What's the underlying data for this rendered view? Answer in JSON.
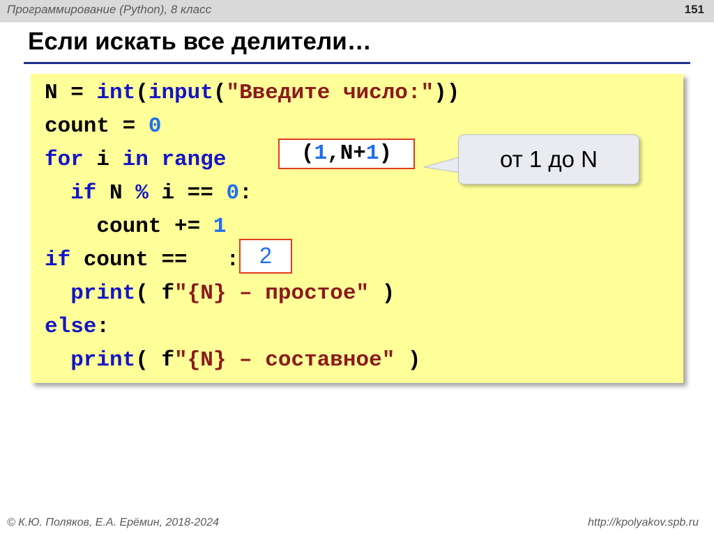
{
  "header": {
    "course": "Программирование (Python), 8 класс",
    "slide_number": "151"
  },
  "title": "Если искать все делители…",
  "code": {
    "line1": {
      "a": "N = ",
      "b": "int",
      "c": "(",
      "d": "input",
      "e": "(",
      "f": "\"Введите число:\"",
      "g": "))"
    },
    "line2": {
      "a": "count = ",
      "b": "0"
    },
    "line3": {
      "a": "for",
      "b": " i ",
      "c": "in",
      "d": " range",
      "e": ":"
    },
    "line4": {
      "a": "  if",
      "b": " N ",
      "c": "%",
      "d": " i == ",
      "e": "0",
      "f": ":"
    },
    "line5": {
      "a": "    count += ",
      "b": "1"
    },
    "line6": {
      "a": "if",
      "b": " count == ",
      "c": "  ",
      "d": ":"
    },
    "line7": {
      "a": "  print",
      "b": "( f",
      "c": "\"{N} – простое\"",
      "d": " )"
    },
    "line8": {
      "a": "else",
      "b": ":"
    },
    "line9": {
      "a": "  print",
      "b": "( f",
      "c": "\"{N} – составное\"",
      "d": " )"
    }
  },
  "highlight_range": {
    "open": "(",
    "one": "1",
    "mid": ",N+",
    "one2": "1",
    "close": ")"
  },
  "highlight_two": "2",
  "callout_text": "от 1 до N",
  "footer": {
    "author": "© К.Ю. Поляков, Е.А. Ерёмин, 2018-2024",
    "url": "http://kpolyakov.spb.ru"
  },
  "colors": {
    "code_bg": "#ffff99",
    "keyword": "#1414c8",
    "string": "#8b1a1a",
    "number": "#1e6ef0",
    "highlight_border": "#e03c1e",
    "title_rule": "#1f2f8f"
  }
}
